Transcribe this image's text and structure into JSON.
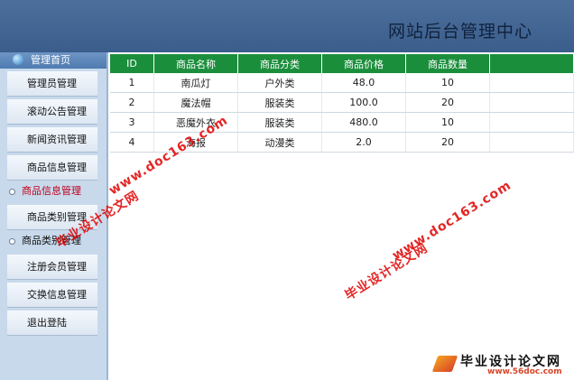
{
  "header": {
    "title": "网站后台管理中心"
  },
  "sidebar": {
    "head": "管理首页",
    "items": [
      {
        "label": "管理员管理",
        "type": "button"
      },
      {
        "label": "滚动公告管理",
        "type": "button"
      },
      {
        "label": "新闻资讯管理",
        "type": "button"
      },
      {
        "label": "商品信息管理",
        "type": "button"
      },
      {
        "label": "商品信息管理",
        "type": "sub-active"
      },
      {
        "label": "商品类别管理",
        "type": "button"
      },
      {
        "label": "商品类别管理",
        "type": "sub"
      },
      {
        "label": "注册会员管理",
        "type": "button"
      },
      {
        "label": "交换信息管理",
        "type": "button"
      },
      {
        "label": "退出登陆",
        "type": "button"
      }
    ]
  },
  "table": {
    "headers": [
      "ID",
      "商品名称",
      "商品分类",
      "商品价格",
      "商品数量",
      ""
    ],
    "rows": [
      [
        "1",
        "南瓜灯",
        "户外类",
        "48.0",
        "10",
        ""
      ],
      [
        "2",
        "魔法帽",
        "服装类",
        "100.0",
        "20",
        ""
      ],
      [
        "3",
        "恶魔外衣",
        "服装类",
        "480.0",
        "10",
        ""
      ],
      [
        "4",
        "海报",
        "动漫类",
        "2.0",
        "20",
        ""
      ]
    ]
  },
  "watermarks": [
    "毕业设计论文网",
    "www.doc163.com"
  ],
  "logo": {
    "text": "毕业设计论文网",
    "url": "www.56doc.com"
  },
  "colors": {
    "header": "#3a5d8b",
    "table_header": "#1b8e3c",
    "sidebar": "#c8d9ec",
    "active": "#c0001a",
    "watermark": "#e00000"
  }
}
